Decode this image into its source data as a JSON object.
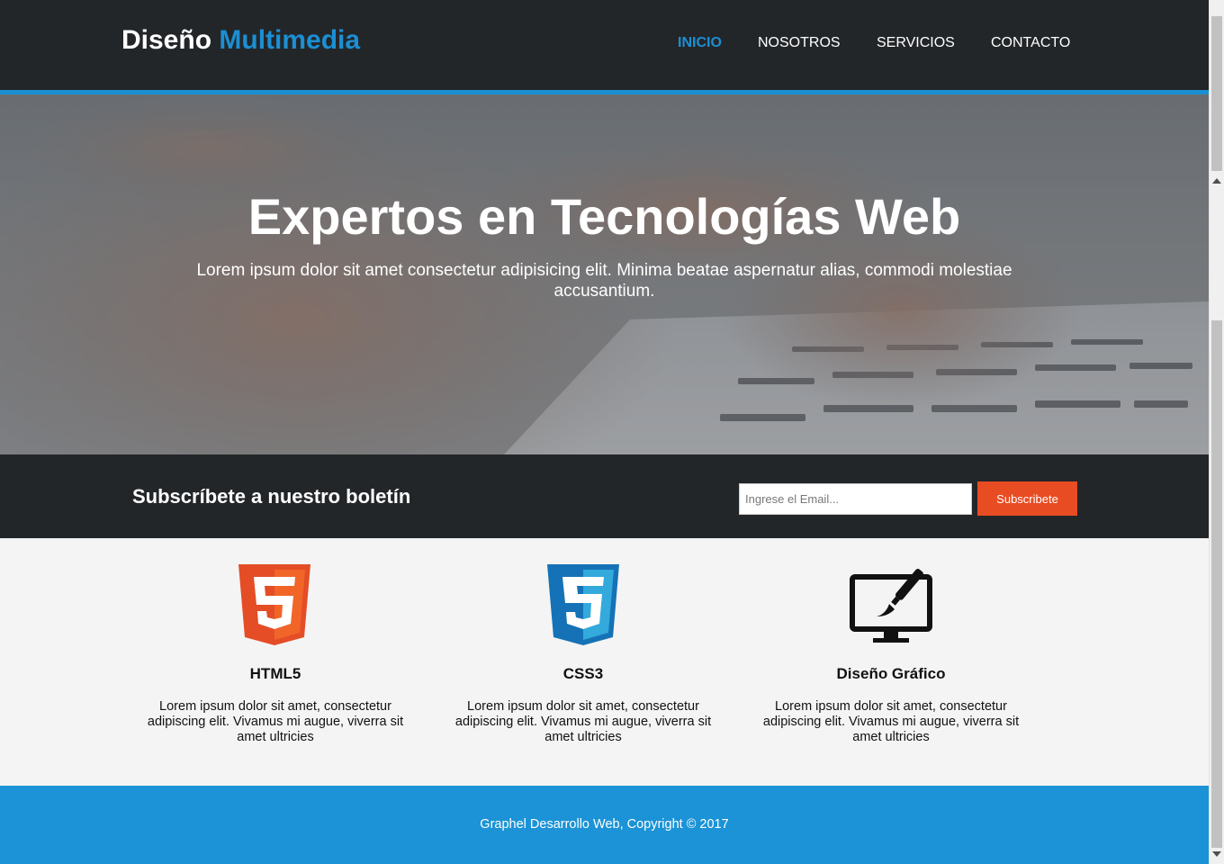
{
  "header": {
    "logo_main": "Diseño",
    "logo_highlight": "Multimedia",
    "nav": [
      {
        "label": "INICIO",
        "active": true
      },
      {
        "label": "NOSOTROS",
        "active": false
      },
      {
        "label": "SERVICIOS",
        "active": false
      },
      {
        "label": "CONTACTO",
        "active": false
      }
    ]
  },
  "hero": {
    "title": "Expertos en Tecnologías Web",
    "subtitle": "Lorem ipsum dolor sit amet consectetur adipisicing elit. Minima beatae aspernatur alias, commodi molestiae accusantium."
  },
  "newsletter": {
    "title": "Subscríbete a nuestro boletín",
    "email_placeholder": "Ingrese el Email...",
    "button_label": "Subscribete"
  },
  "features": [
    {
      "icon": "html5-icon",
      "title": "HTML5",
      "text": "Lorem ipsum dolor sit amet, consectetur adipiscing elit. Vivamus mi augue, viverra sit amet ultricies"
    },
    {
      "icon": "css3-icon",
      "title": "CSS3",
      "text": "Lorem ipsum dolor sit amet, consectetur adipiscing elit. Vivamus mi augue, viverra sit amet ultricies"
    },
    {
      "icon": "graphic-design-monitor-icon",
      "title": "Diseño Gráfico",
      "text": "Lorem ipsum dolor sit amet, consectetur adipiscing elit. Vivamus mi augue, viverra sit amet ultricies"
    }
  ],
  "footer": {
    "text": "Graphel Desarrollo Web, Copyright © 2017"
  },
  "colors": {
    "dark": "#232629",
    "accent_blue": "#1b8fd3",
    "button_orange": "#e84c22",
    "footer_blue": "#1b93d6"
  }
}
